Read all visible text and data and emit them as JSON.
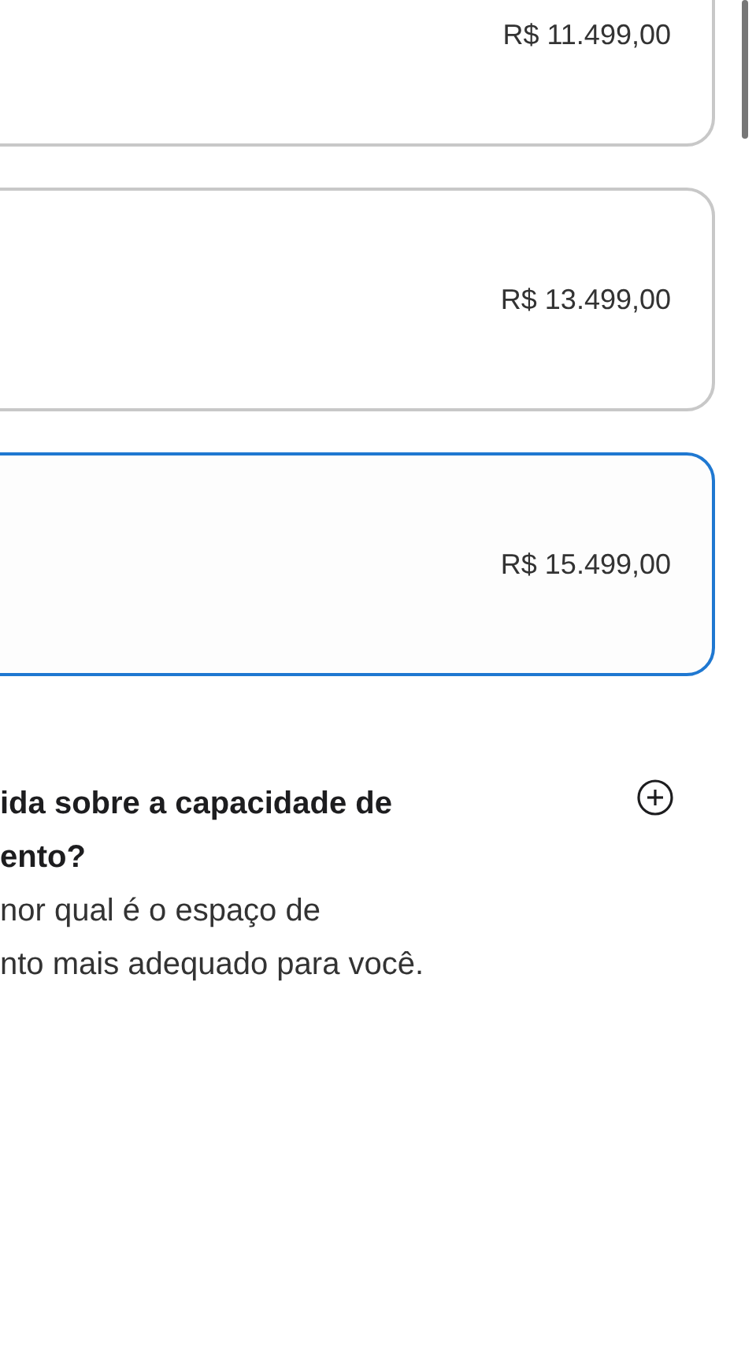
{
  "options": [
    {
      "price": "R$ 11.499,00",
      "selected": false
    },
    {
      "price": "R$ 13.499,00",
      "selected": false
    },
    {
      "price": "R$ 15.499,00",
      "selected": true
    }
  ],
  "faq": {
    "title_lines": [
      "ida sobre a capacidade de",
      "ento?"
    ],
    "body_lines": [
      "nor qual é o espaço de",
      "nto mais adequado para você."
    ],
    "expanded": false
  }
}
